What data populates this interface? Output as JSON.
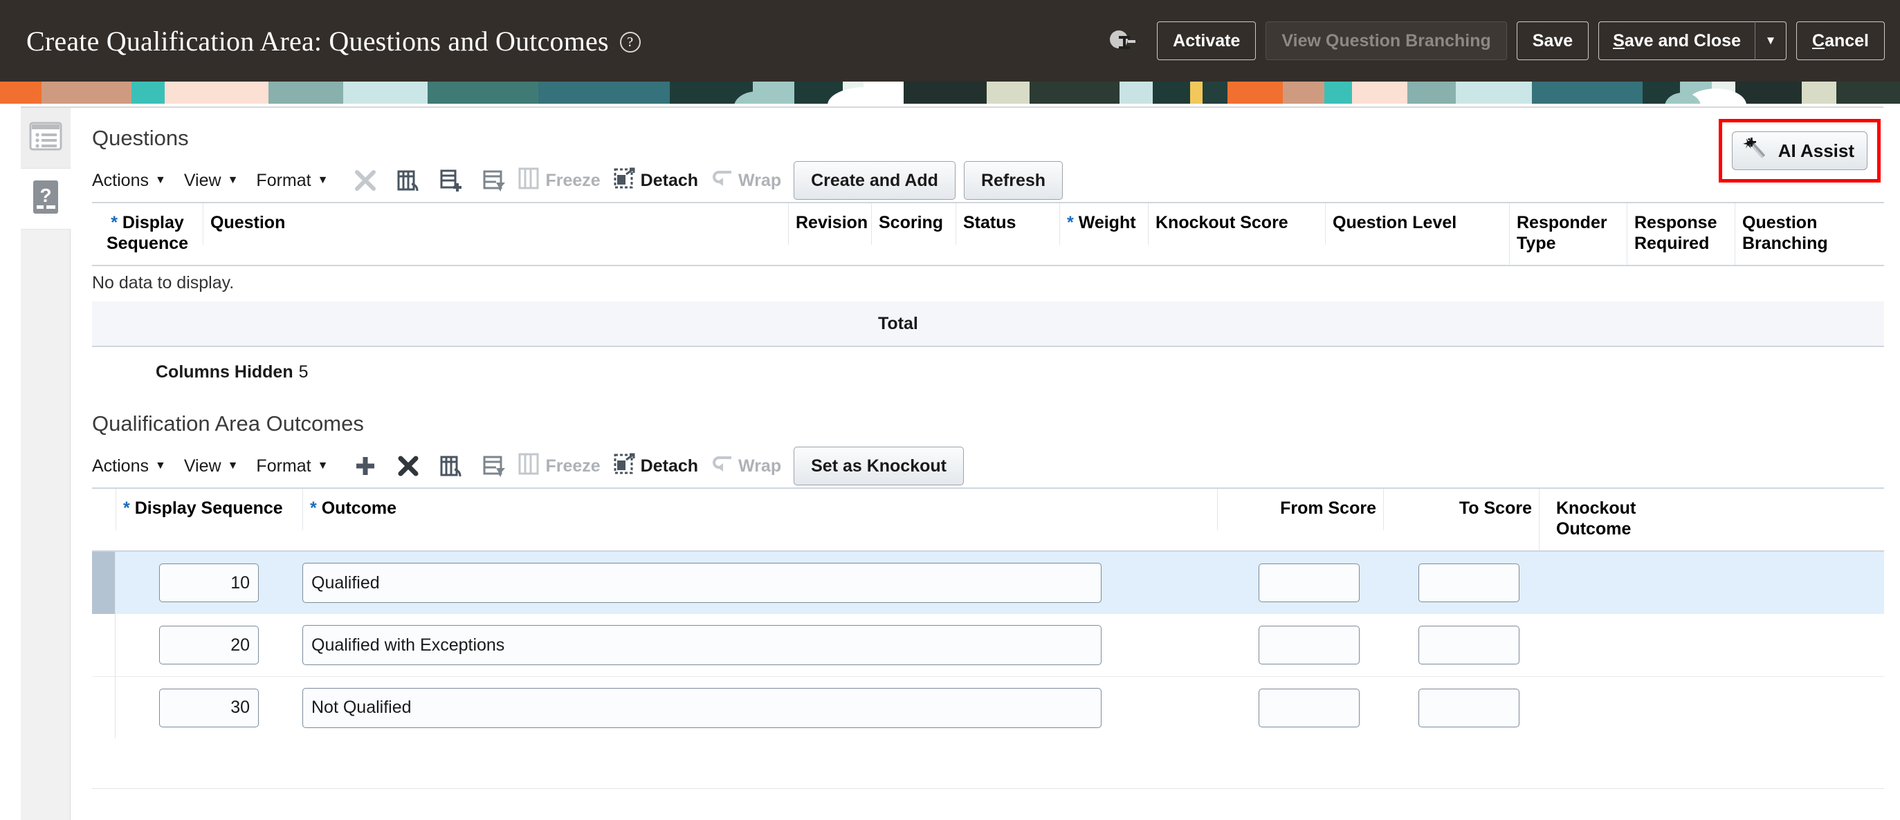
{
  "header": {
    "title": "Create Qualification Area: Questions and Outcomes",
    "help_icon": "help-circle-icon",
    "cursor_icon": "text-cursor-icon",
    "buttons": {
      "activate": "Activate",
      "view_question_branching": "View Question Branching",
      "save": "Save",
      "save_and_close": "Save and Close",
      "save_and_close_arrow": "▼",
      "cancel": "Cancel"
    }
  },
  "sidebar": {
    "items": [
      {
        "name": "outline-panel-tab",
        "icon": "window-list-icon",
        "active": true
      },
      {
        "name": "questions-panel-tab",
        "icon": "question-document-icon",
        "active": false
      }
    ]
  },
  "questions": {
    "section_title": "Questions",
    "ai_assist": {
      "label": "AI Assist",
      "icon": "magic-wand-icon",
      "highlight_color": "#fc0000"
    },
    "toolbar": {
      "actions": "Actions",
      "view": "View",
      "format": "Format",
      "caret": "▼",
      "icons": [
        {
          "name": "delete-row-icon",
          "enabled": false
        },
        {
          "name": "insert-columns-icon",
          "enabled": true
        },
        {
          "name": "duplicate-row-icon",
          "enabled": true
        },
        {
          "name": "query-by-example-icon",
          "enabled": false
        },
        {
          "name": "freeze-icon",
          "enabled": false
        },
        {
          "name": "detach-icon",
          "enabled": true
        },
        {
          "name": "wrap-icon",
          "enabled": false
        }
      ],
      "freeze": "Freeze",
      "detach": "Detach",
      "wrap": "Wrap",
      "create_and_add": "Create and Add",
      "refresh": "Refresh"
    },
    "columns": [
      {
        "label": "Display Sequence",
        "required": true
      },
      {
        "label": "Question",
        "required": false
      },
      {
        "label": "Revision",
        "required": false
      },
      {
        "label": "Scoring",
        "required": false
      },
      {
        "label": "Status",
        "required": false
      },
      {
        "label": "Weight",
        "required": true
      },
      {
        "label": "Knockout Score",
        "required": false
      },
      {
        "label": "Question Level",
        "required": false
      },
      {
        "label": "Responder Type",
        "required": false
      },
      {
        "label": "Response Required",
        "required": false
      },
      {
        "label": "Question Branching",
        "required": false
      }
    ],
    "empty_message": "No data to display.",
    "total_label": "Total",
    "columns_hidden_label": "Columns Hidden",
    "columns_hidden_count": "5"
  },
  "outcomes": {
    "section_title": "Qualification Area Outcomes",
    "toolbar": {
      "actions": "Actions",
      "view": "View",
      "format": "Format",
      "caret": "▼",
      "icons": [
        {
          "name": "add-row-icon",
          "enabled": true
        },
        {
          "name": "delete-row-icon",
          "enabled": true
        },
        {
          "name": "insert-columns-icon",
          "enabled": true
        },
        {
          "name": "query-by-example-icon",
          "enabled": false
        },
        {
          "name": "freeze-icon",
          "enabled": false
        },
        {
          "name": "detach-icon",
          "enabled": true
        },
        {
          "name": "wrap-icon",
          "enabled": false
        }
      ],
      "freeze": "Freeze",
      "detach": "Detach",
      "wrap": "Wrap",
      "set_as_knockout": "Set as Knockout"
    },
    "columns": [
      {
        "label": "Display Sequence",
        "required": true
      },
      {
        "label": "Outcome",
        "required": true
      },
      {
        "label": "From Score",
        "required": false
      },
      {
        "label": "To Score",
        "required": false
      },
      {
        "label": "Knockout Outcome",
        "required": false
      }
    ],
    "rows": [
      {
        "display_sequence": "10",
        "outcome": "Qualified",
        "from_score": "",
        "to_score": "",
        "knockout_outcome": "",
        "selected": true
      },
      {
        "display_sequence": "20",
        "outcome": "Qualified with Exceptions",
        "from_score": "",
        "to_score": "",
        "knockout_outcome": "",
        "selected": false
      },
      {
        "display_sequence": "30",
        "outcome": "Not Qualified",
        "from_score": "",
        "to_score": "",
        "knockout_outcome": "",
        "selected": false
      }
    ]
  }
}
